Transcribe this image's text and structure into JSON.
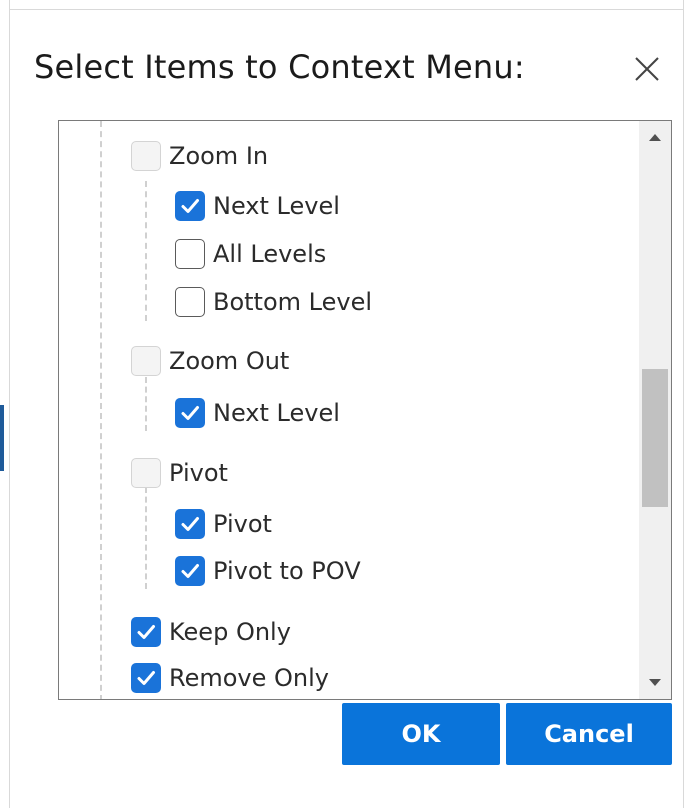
{
  "dialog": {
    "title": "Select Items to Context Menu:",
    "close_icon": "close-icon"
  },
  "tree": {
    "groups": [
      {
        "label": "Zoom In",
        "state": "indeterminate",
        "children": [
          {
            "label": "Next Level",
            "checked": true
          },
          {
            "label": "All Levels",
            "checked": false
          },
          {
            "label": "Bottom Level",
            "checked": false
          }
        ]
      },
      {
        "label": "Zoom Out",
        "state": "indeterminate",
        "children": [
          {
            "label": "Next Level",
            "checked": true
          }
        ]
      },
      {
        "label": "Pivot",
        "state": "indeterminate",
        "children": [
          {
            "label": "Pivot",
            "checked": true
          },
          {
            "label": "Pivot to POV",
            "checked": true
          }
        ]
      }
    ],
    "items": [
      {
        "label": "Keep Only",
        "checked": true
      },
      {
        "label": "Remove Only",
        "checked": true
      }
    ]
  },
  "buttons": {
    "ok_label": "OK",
    "cancel_label": "Cancel"
  },
  "colors": {
    "accent": "#0a74da",
    "checkbox_checked": "#1a73d9"
  }
}
